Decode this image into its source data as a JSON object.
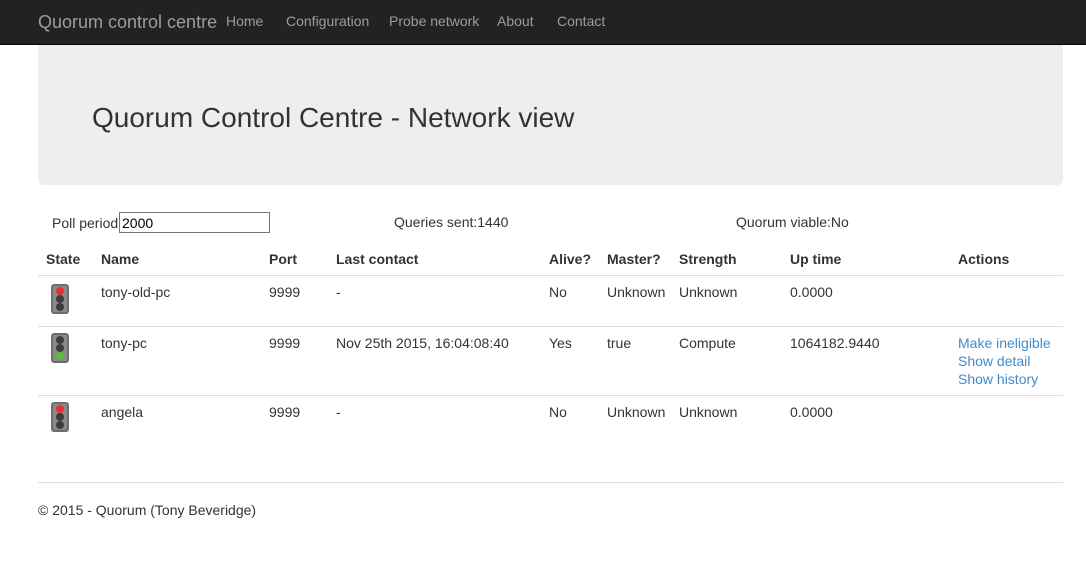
{
  "navbar": {
    "brand": "Quorum control centre",
    "links": [
      "Home",
      "Configuration",
      "Probe network",
      "About",
      "Contact"
    ]
  },
  "jumbotron": {
    "title": "Quorum Control Centre - Network view"
  },
  "stats": {
    "poll_label": "Poll period:",
    "poll_value": "2000",
    "queries_sent": "Queries sent:1440",
    "quorum_viable": "Quorum viable:No"
  },
  "table": {
    "headers": [
      "State",
      "Name",
      "Port",
      "Last contact",
      "Alive?",
      "Master?",
      "Strength",
      "Up time",
      "Actions"
    ],
    "rows": [
      {
        "state": "red",
        "name": "tony-old-pc",
        "port": "9999",
        "last_contact": "-",
        "alive": "No",
        "master": "Unknown",
        "strength": "Unknown",
        "uptime": "0.0000",
        "actions": []
      },
      {
        "state": "green",
        "name": "tony-pc",
        "port": "9999",
        "last_contact": "Nov 25th 2015, 16:04:08:40",
        "alive": "Yes",
        "master": "true",
        "strength": "Compute",
        "uptime": "1064182.9440",
        "actions": [
          "Make ineligible",
          "Show detail",
          "Show history"
        ]
      },
      {
        "state": "red",
        "name": "angela",
        "port": "9999",
        "last_contact": "-",
        "alive": "No",
        "master": "Unknown",
        "strength": "Unknown",
        "uptime": "0.0000",
        "actions": []
      }
    ]
  },
  "footer": {
    "text": "© 2015 - Quorum (Tony Beveridge)"
  },
  "colors": {
    "navbar_bg": "#222222",
    "link": "#428bca",
    "light_red": "#e8312e",
    "light_green": "#5cbf3a",
    "light_off": "#3c3c3c"
  },
  "icons": {
    "state": "traffic-light-icon"
  }
}
